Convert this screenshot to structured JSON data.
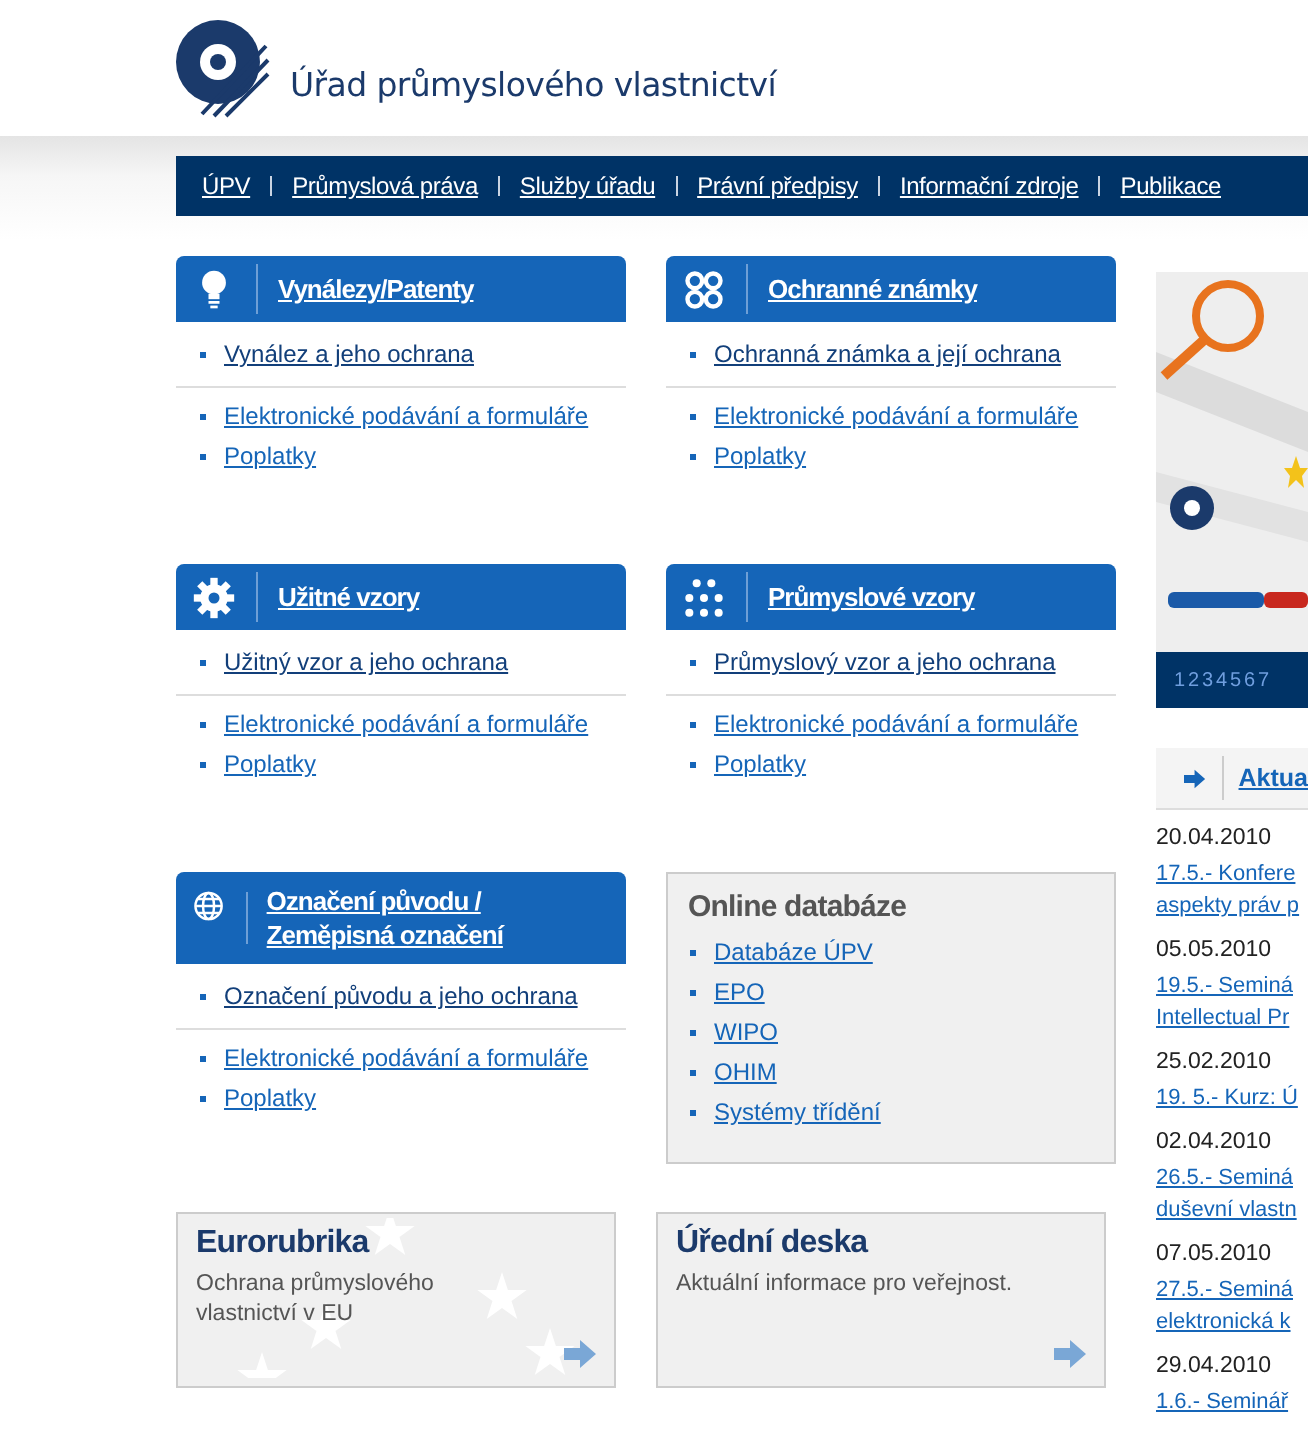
{
  "header": {
    "title": "Úřad průmyslového vlastnictví"
  },
  "nav": [
    {
      "label": "ÚPV"
    },
    {
      "label": "Průmyslová práva"
    },
    {
      "label": "Služby úřadu"
    },
    {
      "label": "Právní předpisy"
    },
    {
      "label": "Informační zdroje"
    },
    {
      "label": "Publikace"
    }
  ],
  "sections": [
    {
      "kind": "bulb",
      "title": "Vynálezy/Patenty",
      "main_link": "Vynález a jeho ochrana",
      "links": [
        "Elektronické podávání a formuláře",
        "Poplatky"
      ]
    },
    {
      "kind": "knot",
      "title": "Ochranné známky",
      "main_link": "Ochranná známka a její ochrana",
      "links": [
        "Elektronické podávání a formuláře",
        "Poplatky"
      ]
    },
    {
      "kind": "gear",
      "title": "Užitné vzory",
      "main_link": "Užitný vzor a jeho ochrana",
      "links": [
        "Elektronické podávání a formuláře",
        "Poplatky"
      ]
    },
    {
      "kind": "dots",
      "title": "Průmyslové vzory",
      "main_link": "Průmyslový vzor a jeho ochrana",
      "links": [
        "Elektronické podávání a formuláře",
        "Poplatky"
      ]
    },
    {
      "kind": "globe",
      "title": "Označení původu / Zeměpisná označení",
      "main_link": "Označení původu a jeho ochrana",
      "links": [
        "Elektronické podávání a formuláře",
        "Poplatky"
      ]
    }
  ],
  "databases": {
    "title": "Online databáze",
    "links": [
      "Databáze ÚPV",
      "EPO",
      "WIPO",
      "OHIM",
      "Systémy třídění"
    ]
  },
  "promos": [
    {
      "kind": "stars",
      "title": "Eurorubrika",
      "text": "Ochrana průmyslového vlastnictví v EU"
    },
    {
      "kind": "plain",
      "title": "Úřední deska",
      "text": "Aktuální informace pro veřejnost."
    }
  ],
  "sidebar": {
    "pager": [
      "1",
      "2",
      "3",
      "4",
      "5",
      "6",
      "7"
    ],
    "news_heading": "Aktua",
    "news": [
      {
        "date": "20.04.2010",
        "lines": [
          "17.5.- Konfere",
          "aspekty práv p"
        ]
      },
      {
        "date": "05.05.2010",
        "lines": [
          "19.5.- Seminá",
          "Intellectual Pr"
        ]
      },
      {
        "date": "25.02.2010",
        "lines": [
          "19. 5.- Kurz: Ú"
        ]
      },
      {
        "date": "02.04.2010",
        "lines": [
          "26.5.- Seminá",
          "duševní vlastn"
        ]
      },
      {
        "date": "07.05.2010",
        "lines": [
          "27.5.- Seminá",
          "elektronická k"
        ]
      },
      {
        "date": "29.04.2010",
        "lines": [
          "1.6.- Seminář"
        ]
      }
    ]
  }
}
